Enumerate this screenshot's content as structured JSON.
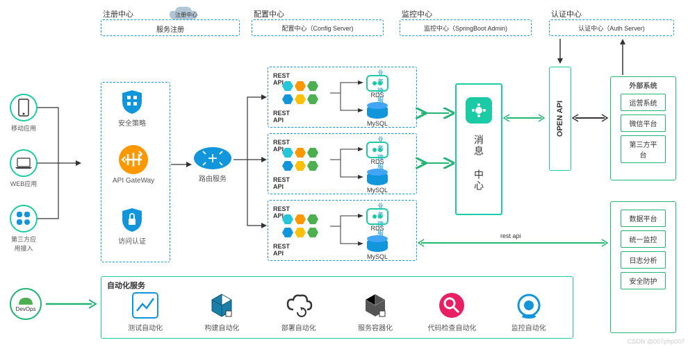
{
  "top": {
    "reg_center": "注册中心",
    "reg_cloud": "注册中心",
    "reg_box": "服务注册",
    "cfg_center": "配置中心",
    "cfg_box": "配置中心（Config Server)",
    "mon_center": "监控中心",
    "mon_box": "监控中心（SpringBoot Admin)",
    "auth_center": "认证中心",
    "auth_box": "认证中心（Auth Server)"
  },
  "clients": {
    "mobile": "移动应用",
    "web": "WEB应用",
    "third": "第三方应\n用接入"
  },
  "gateway": {
    "security": "安全策略",
    "api_gw": "API GateWay",
    "auth": "访问认证"
  },
  "router": "路由服务",
  "microservice": {
    "title": "业务微服务",
    "rest_api": "REST API",
    "rds": "RDS",
    "mysql": "MySQL"
  },
  "message_center": "消息\n中心",
  "open_api": "OPEN API",
  "external": {
    "title": "外部系统",
    "op": "运营系统",
    "wx": "微信平台",
    "third": "第三方平台"
  },
  "rest_api_label": "rest api",
  "platforms": {
    "data": "数据平台",
    "monitor": "统一监控",
    "log": "日志分析",
    "sec": "安全防护"
  },
  "devops": "DevOps",
  "automation": {
    "title": "自动化服务",
    "test": "测试自动化",
    "build": "构建自动化",
    "deploy": "部署自动化",
    "container": "服务容器化",
    "code": "代码检查自动化",
    "monitor": "监控自动化"
  },
  "watermark": "CSDN @007php007"
}
